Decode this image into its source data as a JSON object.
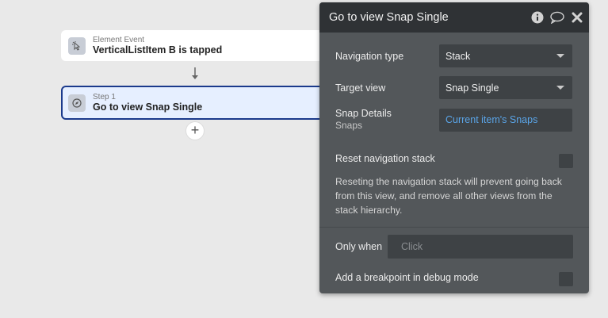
{
  "canvas": {
    "event_card": {
      "kind": "Element Event",
      "title": "VerticalListItem B is tapped"
    },
    "step_card": {
      "kind": "Step 1",
      "title": "Go to view Snap Single"
    },
    "add_step": "+"
  },
  "panel": {
    "title": "Go to view Snap Single",
    "navigation_type": {
      "label": "Navigation type",
      "value": "Stack"
    },
    "target_view": {
      "label": "Target view",
      "value": "Snap Single"
    },
    "snap_details": {
      "label": "Snap Details",
      "sublabel": "Snaps",
      "value": "Current item's Snaps"
    },
    "reset_stack": {
      "label": "Reset navigation stack",
      "description": "Reseting the navigation stack will prevent going back from this view, and remove all other views from the stack hierarchy."
    },
    "only_when": {
      "label": "Only when",
      "placeholder": "Click"
    },
    "breakpoint": {
      "label": "Add a breakpoint in debug mode"
    }
  },
  "colors": {
    "panel_bg": "#53575a",
    "header_bg": "#2f3235",
    "dynamic_text": "#5aa5e8",
    "step_border": "#1b3a8c"
  }
}
